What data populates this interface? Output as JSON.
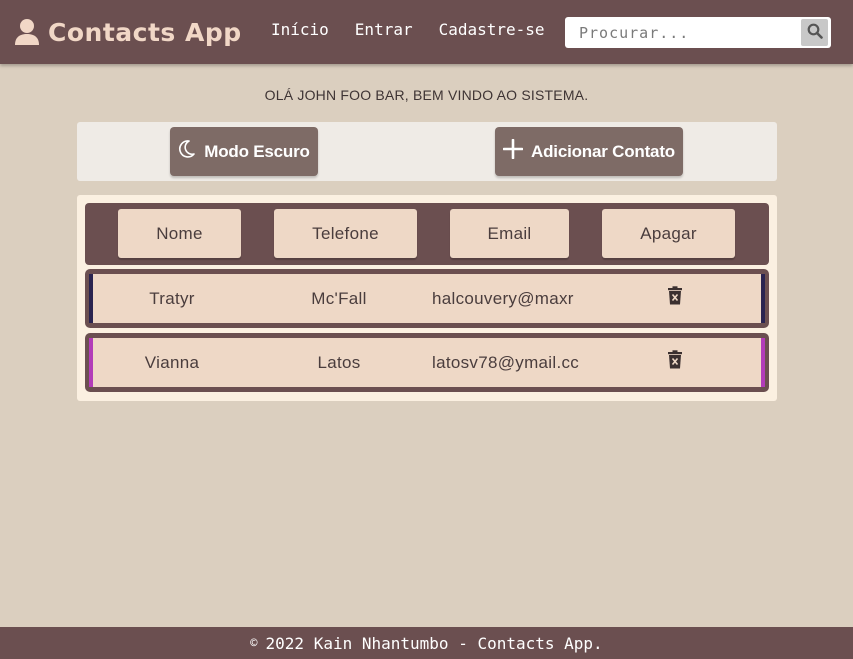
{
  "header": {
    "brand_icon": "user-icon",
    "brand_title": "Contacts App",
    "nav": [
      {
        "label": "Início"
      },
      {
        "label": "Entrar"
      },
      {
        "label": "Cadastre-se"
      }
    ],
    "search": {
      "placeholder": "Procurar...",
      "value": "",
      "button_icon": "search-icon"
    }
  },
  "greeting": "OLÁ JOHN FOO BAR, BEM VINDO AO SISTEMA.",
  "actions": {
    "dark_mode": {
      "label": "Modo Escuro",
      "icon": "moon-icon"
    },
    "add_contact": {
      "label": "Adicionar Contato",
      "icon": "plus-icon"
    }
  },
  "table": {
    "columns": [
      "Nome",
      "Telefone",
      "Email",
      "Apagar"
    ],
    "rows": [
      {
        "first_name": "Tratyr",
        "last_name": "Mc'Fall",
        "email": "halcouvery@maxr",
        "accent": "#2a2450",
        "delete_icon": "trash-icon"
      },
      {
        "first_name": "Vianna",
        "last_name": "Latos",
        "email": "latosv78@ymail.cc",
        "accent": "#b23cb8",
        "delete_icon": "trash-icon"
      }
    ]
  },
  "footer": {
    "copyright_symbol": "©",
    "text": "2022 Kain Nhantumbo - Contacts App."
  },
  "colors": {
    "primary": "#6b4f50",
    "background": "#dbcfbf",
    "cell": "#eed8c6",
    "button": "#7e6b66",
    "brand_text": "#f1d7c6"
  }
}
